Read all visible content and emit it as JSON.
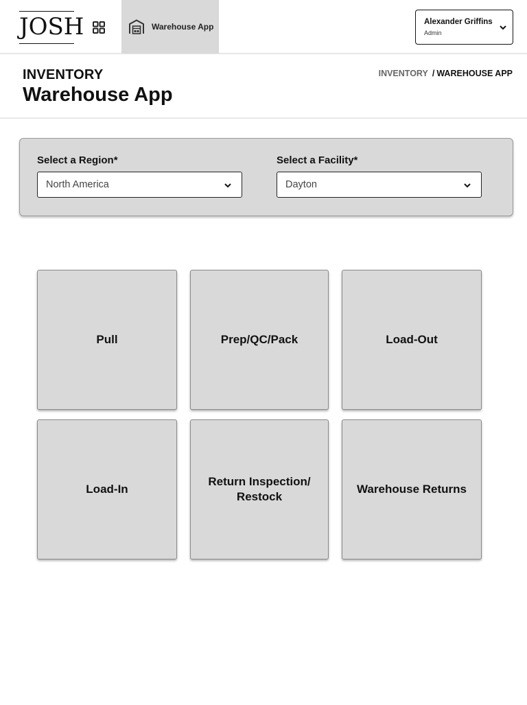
{
  "topbar": {
    "logo_text": "JOSH",
    "app_tab_label": "Warehouse App",
    "user": {
      "name": "Alexander Griffins",
      "role": "Admin"
    },
    "icons": {
      "apps": "grid-icon",
      "app_tab": "warehouse-icon",
      "user_menu": "chevron-down-icon"
    }
  },
  "header": {
    "section": "INVENTORY",
    "title": "Warehouse App",
    "breadcrumb": {
      "root": "INVENTORY",
      "separator": "/",
      "current": "WAREHOUSE APP"
    }
  },
  "filters": {
    "region": {
      "label": "Select a Region*",
      "value": "North America"
    },
    "facility": {
      "label": "Select a Facility*",
      "value": "Dayton"
    }
  },
  "tiles": [
    {
      "label": "Pull"
    },
    {
      "label": "Prep/QC/Pack"
    },
    {
      "label": "Load-Out"
    },
    {
      "label": "Load-In"
    },
    {
      "label": "Return Inspection/\nRestock"
    },
    {
      "label": "Warehouse Returns"
    }
  ],
  "colors": {
    "tile_bg": "#d9d9d9",
    "panel_bg": "#d9d9d9",
    "active_tab_bg": "#d9d9d9",
    "text": "#111111"
  }
}
